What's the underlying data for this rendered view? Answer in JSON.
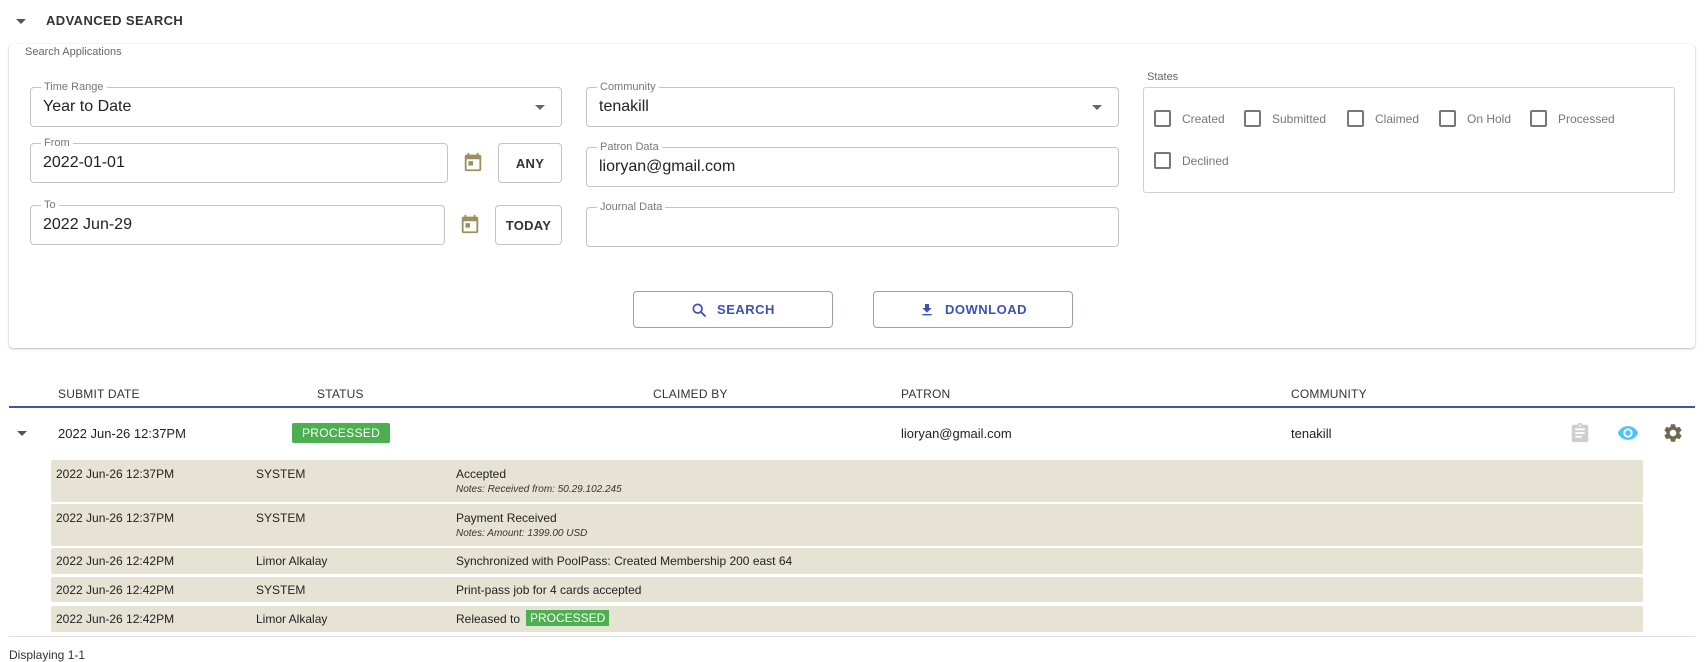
{
  "header": {
    "title": "ADVANCED SEARCH"
  },
  "search": {
    "panel_title": "Search Applications",
    "time_range": {
      "label": "Time Range",
      "value": "Year to Date"
    },
    "from": {
      "label": "From",
      "value": "2022-01-01",
      "button": "ANY"
    },
    "to": {
      "label": "To",
      "value": "2022 Jun-29",
      "button": "TODAY"
    },
    "community": {
      "label": "Community",
      "value": "tenakill"
    },
    "patron": {
      "label": "Patron Data",
      "value": "lioryan@gmail.com"
    },
    "journal": {
      "label": "Journal Data",
      "value": ""
    },
    "states": {
      "title": "States",
      "items": [
        "Created",
        "Submitted",
        "Claimed",
        "On Hold",
        "Processed",
        "Declined"
      ]
    },
    "search_button": "SEARCH",
    "download_button": "DOWNLOAD"
  },
  "table": {
    "columns": [
      "SUBMIT DATE",
      "STATUS",
      "CLAIMED BY",
      "PATRON",
      "COMMUNITY"
    ],
    "row": {
      "submit_date": "2022 Jun-26 12:37PM",
      "status": "PROCESSED",
      "claimed_by": "",
      "patron": "lioryan@gmail.com",
      "community": "tenakill"
    },
    "journal": [
      {
        "date": "2022 Jun-26 12:37PM",
        "actor": "SYSTEM",
        "text": "Accepted",
        "note": "Notes: Received from: 50.29.102.245"
      },
      {
        "date": "2022 Jun-26 12:37PM",
        "actor": "SYSTEM",
        "text": "Payment Received",
        "note": "Notes: Amount: 1399.00 USD"
      },
      {
        "date": "2022 Jun-26 12:42PM",
        "actor": "Limor Alkalay",
        "text": "Synchronized with PoolPass: Created Membership 200 east 64"
      },
      {
        "date": "2022 Jun-26 12:42PM",
        "actor": "SYSTEM",
        "text": "Print-pass job for 4 cards accepted"
      },
      {
        "date": "2022 Jun-26 12:42PM",
        "actor": "Limor Alkalay",
        "text": "Released to",
        "badge": "PROCESSED"
      }
    ]
  },
  "footer": {
    "text": "Displaying 1-1"
  },
  "colors": {
    "accent": "#3f51b5",
    "status_green": "#4caf50",
    "detail_bg": "#e6e3d5",
    "eye": "#4fc3f7"
  }
}
